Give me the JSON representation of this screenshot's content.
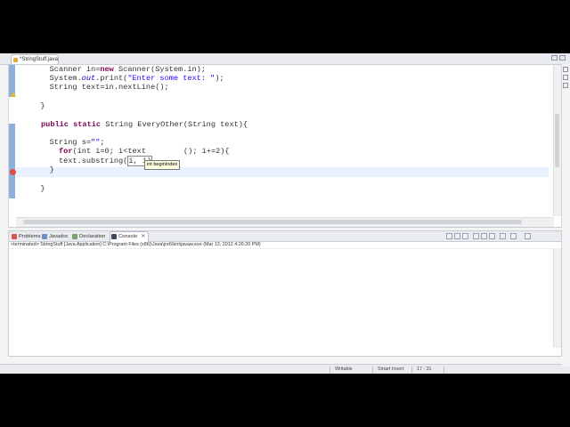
{
  "editor": {
    "tab_label": "*StringStuff.java",
    "lines": [
      {
        "pre": "    Scanner in=",
        "kw": "new",
        "post": " Scanner(System.in);"
      },
      {
        "pre": "    System.",
        "st": "out",
        "post": ".print(",
        "str": "\"Enter some text: \"",
        "end": ");"
      },
      {
        "pre": "    String text=in.nextLine();"
      },
      {
        "pre": "  }"
      },
      {
        "kw": "public static",
        "post": " String EveryOther(String text){"
      },
      {
        "pre": "    String s=",
        "str": "\"\"",
        "end": ";"
      },
      {
        "kw": "for",
        "post": "(int i=0; i<text",
        "end": "(); i+=2){"
      },
      {
        "pre": "      text.substring(",
        "end": "i, i)"
      },
      {
        "pre": "    }"
      },
      {
        "pre": "  }"
      }
    ],
    "param_hint": "int beginIndex"
  },
  "panel": {
    "tabs": [
      {
        "label": "Problems"
      },
      {
        "label": "Javadoc"
      },
      {
        "label": "Declaration"
      },
      {
        "label": "Console",
        "close": "✕"
      }
    ],
    "console_path": "<terminated> StringStuff [Java Application] C:\\Program Files (x86)\\Java\\jre6\\bin\\javaw.exe (Mar 13, 2012 4:26:20 PM)"
  },
  "status": {
    "mode": "Writable",
    "insert": "Smart Insert",
    "position": "17 : 31"
  },
  "colors": {
    "keyword": "#7f0055",
    "string": "#2a00ff",
    "static_field": "#0000c0",
    "current_line": "#e8f2fe",
    "gutter_mark": "#8fb0d8"
  }
}
